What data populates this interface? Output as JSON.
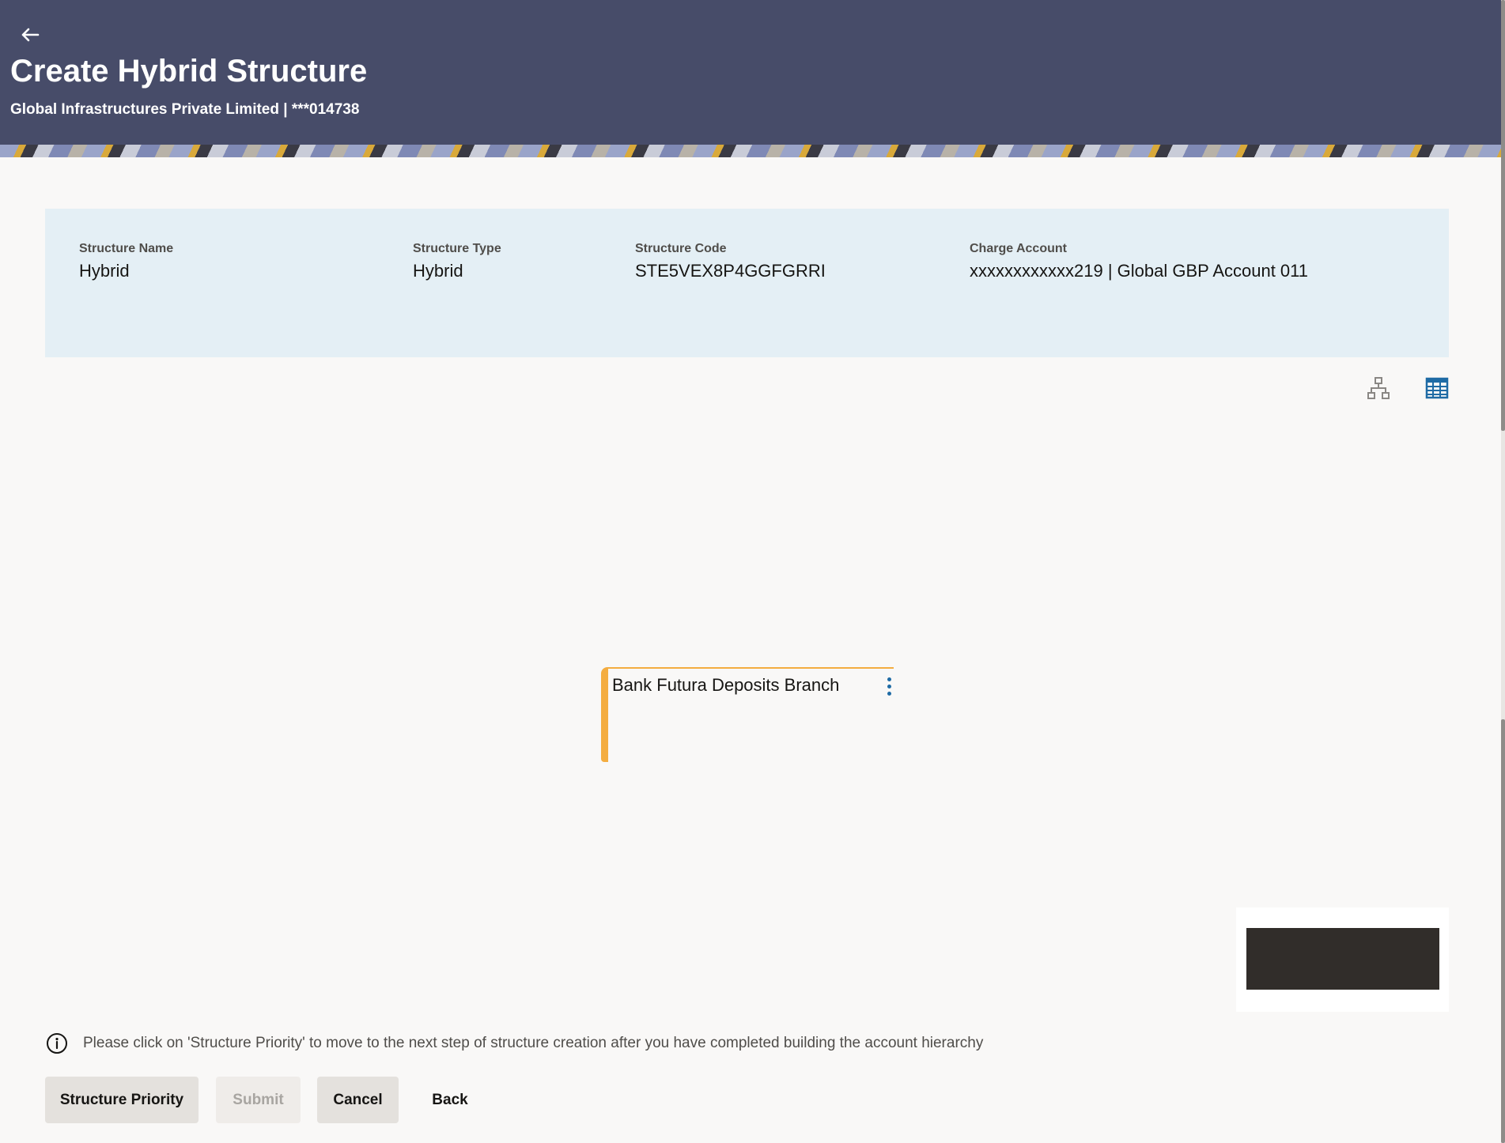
{
  "header": {
    "title": "Create Hybrid Structure",
    "subtitle": "Global Infrastructures Private Limited | ***014738",
    "back_icon": "arrow-left-icon"
  },
  "summary": {
    "structure_name": {
      "label": "Structure Name",
      "value": "Hybrid"
    },
    "structure_type": {
      "label": "Structure Type",
      "value": "Hybrid"
    },
    "structure_code": {
      "label": "Structure Code",
      "value": "STE5VEX8P4GGFGRRI"
    },
    "charge_account": {
      "label": "Charge Account",
      "value": "xxxxxxxxxxxx219 | Global GBP Account 011"
    }
  },
  "view_toggle": {
    "tree_icon": "hierarchy-icon",
    "table_icon": "table-icon"
  },
  "tree": {
    "root_node": {
      "label": "Bank Futura Deposits Branch",
      "menu_icon": "kebab-menu-icon"
    }
  },
  "info": {
    "icon": "info-icon",
    "message": "Please click on 'Structure Priority' to move to the next step of structure creation after you have completed building the account hierarchy"
  },
  "actions": {
    "structure_priority": "Structure Priority",
    "submit": "Submit",
    "cancel": "Cancel",
    "back": "Back"
  },
  "colors": {
    "header_bg": "#474c69",
    "summary_bg": "#e4eff5",
    "node_accent": "#f4ad40",
    "link_blue": "#1f6ba5"
  }
}
